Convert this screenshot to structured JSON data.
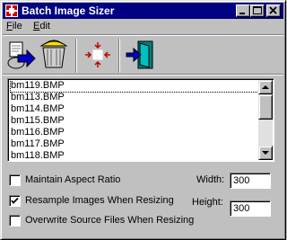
{
  "window": {
    "title": "Batch Image Sizer"
  },
  "menu": [
    {
      "label": "File",
      "accel": "F",
      "rest": "ile"
    },
    {
      "label": "Edit",
      "accel": "E",
      "rest": "dit"
    }
  ],
  "toolbar": [
    {
      "name": "add-files-icon"
    },
    {
      "name": "recycle-bin-icon"
    },
    {
      "name": "resize-icon"
    },
    {
      "name": "exit-icon"
    }
  ],
  "file_list": {
    "items": [
      "bm119.BMP",
      "bm113.BMP",
      "bm114.BMP",
      "bm115.BMP",
      "bm116.BMP",
      "bm117.BMP",
      "bm118.BMP"
    ]
  },
  "options": {
    "maintain_aspect": {
      "label": "Maintain Aspect Ratio",
      "checked": false
    },
    "resample": {
      "label": "Resample Images When Resizing",
      "checked": true
    },
    "overwrite": {
      "label": "Overwrite Source Files When Resizing",
      "checked": false
    }
  },
  "size": {
    "width_label": "Width:",
    "width_value": "300",
    "height_label": "Height:",
    "height_value": "300"
  }
}
